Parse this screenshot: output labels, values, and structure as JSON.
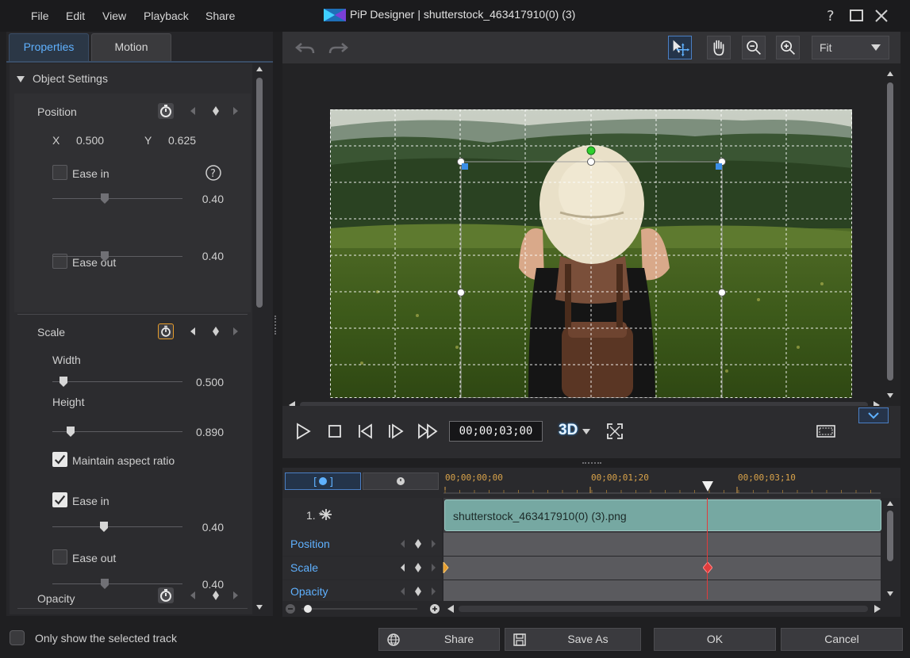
{
  "menu": [
    "File",
    "Edit",
    "View",
    "Playback",
    "Share"
  ],
  "window": {
    "title": "PiP Designer  |  shutterstock_463417910(0) (3)"
  },
  "tabs": {
    "properties": "Properties",
    "motion": "Motion"
  },
  "object_settings": {
    "title": "Object Settings",
    "position": {
      "label": "Position",
      "x_label": "X",
      "x_value": "0.500",
      "y_label": "Y",
      "y_value": "0.625",
      "ease_in_label": "Ease in",
      "ease_in_checked": false,
      "ease_in_value": "0.40",
      "ease_out_label": "Ease out",
      "ease_out_checked": false,
      "ease_out_value": "0.40"
    },
    "scale": {
      "label": "Scale",
      "width_label": "Width",
      "width_value": "0.500",
      "height_label": "Height",
      "height_value": "0.890",
      "maintain_aspect_label": "Maintain aspect ratio",
      "maintain_aspect_checked": true,
      "ease_in_label": "Ease in",
      "ease_in_checked": true,
      "ease_in_value": "0.40",
      "ease_out_label": "Ease out",
      "ease_out_checked": false,
      "ease_out_value": "0.40"
    },
    "opacity": {
      "label": "Opacity"
    }
  },
  "preview": {
    "zoom": "Fit",
    "timeline_progress": 0.6
  },
  "playback": {
    "timecode": "00;00;03;00",
    "mode_3d": "3D"
  },
  "timeline": {
    "ruler": [
      "00;00;00;00",
      "00;00;01;20",
      "00;00;03;10"
    ],
    "track_title": "1. *",
    "clip_name": "shutterstock_463417910(0) (3).png",
    "tracks": [
      "Position",
      "Scale",
      "Opacity"
    ]
  },
  "footer": {
    "only_selected_label": "Only show the selected track",
    "share": "Share",
    "save_as": "Save As",
    "ok": "OK",
    "cancel": "Cancel"
  },
  "colors": {
    "accent": "#5fb1ff",
    "keyframe": "#e79d2b",
    "playhead": "#e03c3c",
    "clip": "#76a8a2"
  }
}
